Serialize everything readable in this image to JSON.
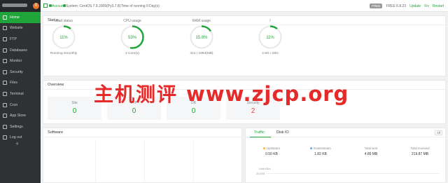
{
  "sidebar": {
    "badge": "0",
    "items": [
      {
        "label": "Home",
        "active": true
      },
      {
        "label": "Website"
      },
      {
        "label": "FTP"
      },
      {
        "label": "Databases"
      },
      {
        "label": "Monitor"
      },
      {
        "label": "Security"
      },
      {
        "label": "Files"
      },
      {
        "label": "Terminal"
      },
      {
        "label": "Cron"
      },
      {
        "label": "App Store"
      },
      {
        "label": "Settings"
      },
      {
        "label": "Log out"
      }
    ],
    "add": "+"
  },
  "topbar": {
    "account": "Account",
    "system": "System: CentOS 7.9.2009(Py3.7.8)",
    "uptime": "Time of running 0 Day(s)",
    "pill": "FREE",
    "version": "FREE  6.8.23",
    "update": "Update",
    "fix": "Fix",
    "restart": "Restart"
  },
  "status": {
    "title": "Status",
    "gauges": [
      {
        "title": "Load status",
        "value": "11%",
        "pct": 11,
        "sub": "Running smoothly"
      },
      {
        "title": "CPU usage",
        "value": "53%",
        "pct": 53,
        "sub": "2 Core(s)"
      },
      {
        "title": "RAM usage",
        "value": "15.8%",
        "pct": 15.8,
        "sub": "314 / 1994(MB)"
      },
      {
        "title": "/",
        "value": "11%",
        "pct": 11,
        "sub": "2.9G / 28G"
      }
    ]
  },
  "overview": {
    "title": "Overview",
    "cards": [
      {
        "name": "Site",
        "value": "0"
      },
      {
        "name": "FTP",
        "value": "0"
      },
      {
        "name": "DB",
        "value": "0"
      },
      {
        "name": "Security",
        "value": "2",
        "alert": true
      }
    ]
  },
  "software": {
    "title": "Software"
  },
  "traffic": {
    "tabs": [
      "Traffic",
      "Disk IO"
    ],
    "select": "All",
    "stats": [
      {
        "label": "Upstream",
        "value": "0.50 KB",
        "color": "#f7b851"
      },
      {
        "label": "Downstream",
        "value": "1.82 KB",
        "color": "#52a9ff"
      },
      {
        "label": "Total sent",
        "value": "4.89 MB"
      },
      {
        "label": "Total received",
        "value": "219.87 MB"
      }
    ],
    "unit": "Unit:KB/s",
    "axis_value": "20,000"
  },
  "watermark": {
    "cn": "主机测评",
    "url": "www.zjcp.org"
  },
  "colors": {
    "accent": "#20a53a",
    "alert": "#ee4444",
    "sidebar": "#2f3133"
  }
}
